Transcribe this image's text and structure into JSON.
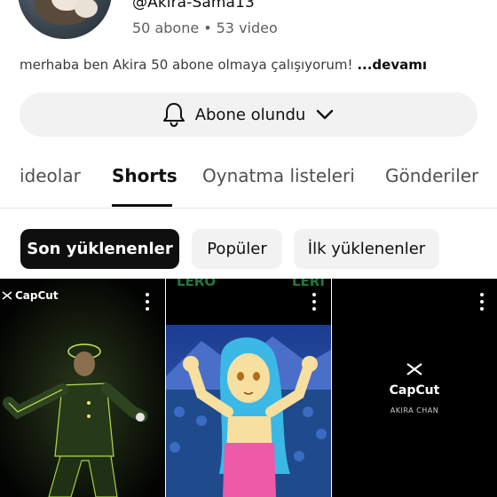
{
  "channel": {
    "handle": "@Akira-Sama13",
    "subscribers": "50 abone",
    "separator": "•",
    "videos": "53 video",
    "description": "merhaba ben Akira 50 abone olmaya çalışıyorum!",
    "more_label": "...devamı"
  },
  "subscribe": {
    "label": "Abone olundu",
    "icon": "bell-icon",
    "dropdown_icon": "chevron-down-icon"
  },
  "tabs": [
    {
      "label": "ideolar",
      "active": false
    },
    {
      "label": "Shorts",
      "active": true
    },
    {
      "label": "Oynatma listeleri",
      "active": false
    },
    {
      "label": "Gönderiler",
      "active": false
    }
  ],
  "chips": [
    {
      "label": "Son yüklenenler",
      "selected": true
    },
    {
      "label": "Popüler",
      "selected": false
    },
    {
      "label": "İlk yüklenenler",
      "selected": false
    }
  ],
  "shorts": [
    {
      "badge": "CapCut"
    },
    {
      "top_left": "LERO",
      "top_right": "LERI"
    },
    {
      "logo": "CapCut",
      "caption": "AKIRA CHAN"
    }
  ],
  "colors": {
    "text": "#0f0f0f",
    "secondary": "#606060",
    "chip_bg": "#f2f2f2",
    "chip_selected_bg": "#0f0f0f"
  }
}
